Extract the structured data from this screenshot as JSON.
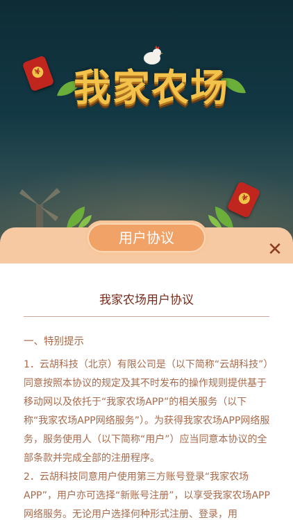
{
  "game": {
    "logo_text": "我家农场"
  },
  "modal": {
    "title": "用户协议",
    "close_label": "✕"
  },
  "document": {
    "title": "我家农场用户协议",
    "section_heading": "一、特别提示",
    "paragraphs": [
      "1．云胡科技（北京）有限公司是（以下简称“云胡科技”）同意按照本协议的规定及其不时发布的操作规则提供基于移动网以及依托于“我家农场APP”的相关服务（以下称“我家农场APP网络服务”）。为获得我家农场APP网络服务，服务使用人（以下简称“用户”）应当同意本协议的全部条款并完成全部的注册程序。",
      "2．云胡科技同意用户使用第三方账号登录“我家农场APP”，用户亦可选择“新账号注册”，以享受我家农场APP网络服务。无论用户选择何种形式注册、登录，用"
    ]
  },
  "decor": {
    "envelope_glyph": "¥"
  },
  "colors": {
    "modal_head": "#f6c9a3",
    "title_pill": "#f1a267",
    "text": "#a86a4b",
    "title_text": "#7a2a1a",
    "close": "#8a3b22"
  }
}
